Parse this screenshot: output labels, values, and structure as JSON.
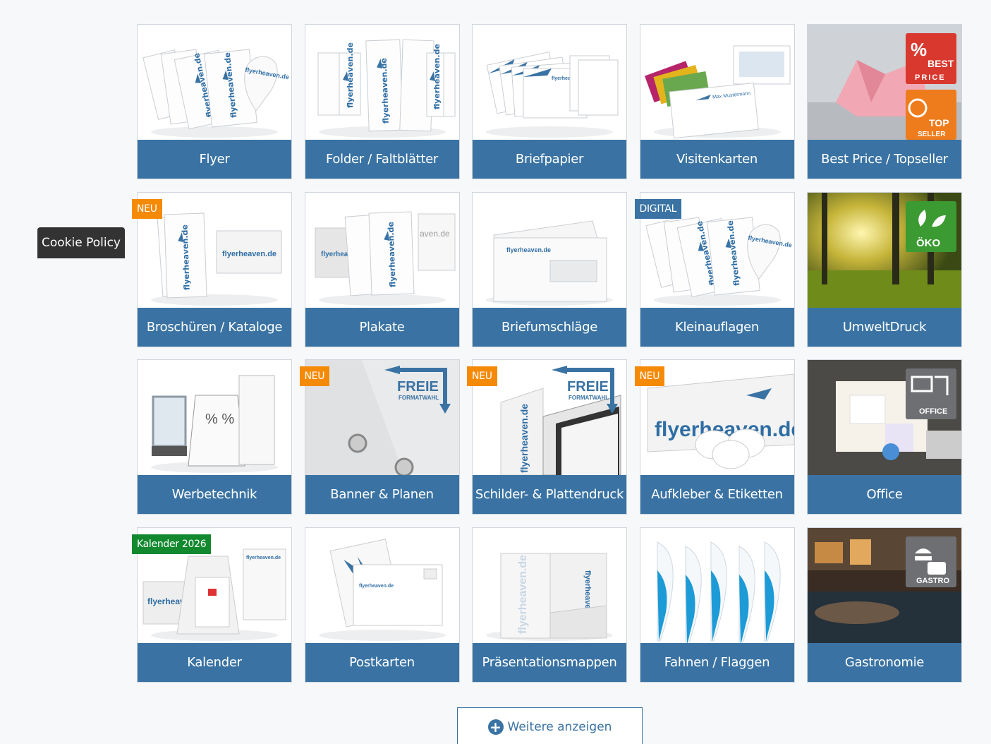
{
  "cookie": {
    "label": "Cookie Policy"
  },
  "more_button": {
    "label": "Weitere anzeigen"
  },
  "brand_text": "flyerheaven.de",
  "categories": [
    {
      "label": "Flyer",
      "badge": "",
      "icon": "flyer-stack-image",
      "kind": "flyer"
    },
    {
      "label": "Folder / Faltblätter",
      "badge": "",
      "icon": "folded-leaflet-image",
      "kind": "folder"
    },
    {
      "label": "Briefpapier",
      "badge": "",
      "icon": "letterhead-image",
      "kind": "letter"
    },
    {
      "label": "Visitenkarten",
      "badge": "",
      "icon": "business-card-image",
      "kind": "cards"
    },
    {
      "label": "Best Price / Topseller",
      "badge": "",
      "icon": "origami-pig-image",
      "kind": "bestprice",
      "overlay": [
        "BEST",
        "PRICE",
        "TOP",
        "SELLER"
      ]
    },
    {
      "label": "Broschüren / Kataloge",
      "badge": "NEU",
      "badge_color": "orange",
      "icon": "brochure-image",
      "kind": "brochure"
    },
    {
      "label": "Plakate",
      "badge": "",
      "icon": "poster-image",
      "kind": "poster"
    },
    {
      "label": "Briefumschläge",
      "badge": "",
      "icon": "envelope-image",
      "kind": "envelope"
    },
    {
      "label": "Kleinauflagen",
      "badge": "DIGITAL",
      "badge_color": "blue",
      "icon": "small-print-image",
      "kind": "flyer"
    },
    {
      "label": "UmweltDruck",
      "badge": "",
      "icon": "forest-image",
      "kind": "forest",
      "overlay": [
        "ÖKO"
      ]
    },
    {
      "label": "Werbetechnik",
      "badge": "",
      "icon": "signage-image",
      "kind": "signage"
    },
    {
      "label": "Banner & Planen",
      "badge": "NEU",
      "badge_color": "orange",
      "icon": "banner-image",
      "kind": "banner",
      "overlay": [
        "FREIE",
        "FORMATWAHL"
      ]
    },
    {
      "label": "Schilder- & Plattendruck",
      "badge": "NEU",
      "badge_color": "orange",
      "icon": "sign-board-image",
      "kind": "boards",
      "overlay": [
        "FREIE",
        "FORMATWAHL"
      ]
    },
    {
      "label": "Aufkleber & Etiketten",
      "badge": "NEU",
      "badge_color": "orange",
      "icon": "sticker-image",
      "kind": "sticker"
    },
    {
      "label": "Office",
      "badge": "",
      "icon": "office-desk-image",
      "kind": "office",
      "overlay": [
        "OFFICE"
      ]
    },
    {
      "label": "Kalender",
      "badge": "Kalender 2026",
      "badge_color": "green",
      "icon": "calendar-image",
      "kind": "calendar"
    },
    {
      "label": "Postkarten",
      "badge": "",
      "icon": "postcard-image",
      "kind": "postcard"
    },
    {
      "label": "Präsentationsmappen",
      "badge": "",
      "icon": "folder-portfolio-image",
      "kind": "portfolio"
    },
    {
      "label": "Fahnen / Flaggen",
      "badge": "",
      "icon": "flag-image",
      "kind": "flags"
    },
    {
      "label": "Gastronomie",
      "badge": "",
      "icon": "restaurant-image",
      "kind": "gastro",
      "overlay": [
        "GASTRO"
      ]
    }
  ],
  "colors": {
    "label_bg": "#3a73a3",
    "badge_orange": "#f58a07",
    "badge_blue": "#3a73a3",
    "badge_green": "#12892f",
    "overlay_red": "#d9382e",
    "overlay_orange": "#ee7c1c",
    "overlay_green": "#3b9a32",
    "overlay_grey": "#6d6f72"
  }
}
